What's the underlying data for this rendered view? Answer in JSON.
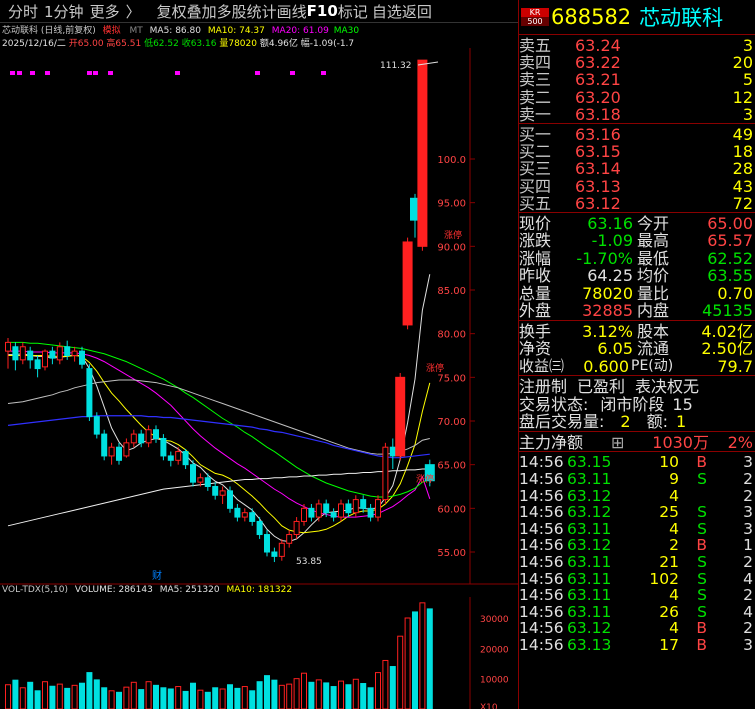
{
  "topbar": {
    "items": [
      "分时",
      "1分钟",
      "更多",
      "〉",
      "复权",
      "叠加",
      "多股",
      "统计",
      "画线",
      "F10",
      "标记",
      "自选",
      "返回"
    ]
  },
  "chart_info": {
    "line1": "芯动联科 (日线,前复权)",
    "tag": "模拟",
    "ma_label": "MT",
    "ma5": "MA5: 86.80",
    "ma10": "MA10: 74.37",
    "ma20": "MA20: 61.09",
    "ma30": "MA30"
  },
  "bar_info": {
    "date": "2025/12/16/二",
    "open": "开65.00",
    "high": "高65.51",
    "low": "低62.52",
    "close": "收63.16",
    "vol": "量78020",
    "amount": "额4.96亿",
    "change": "幅-1.09(-1.7"
  },
  "price_axis": [
    "100.0",
    "95.00",
    "90.00",
    "85.00",
    "80.00",
    "75.00",
    "70.00",
    "65.00",
    "60.00",
    "55.00"
  ],
  "annotations": {
    "high_mark": "111.32",
    "low_mark": "53.85",
    "cai": "财",
    "event1": "涨停",
    "event2": "涨停",
    "event3": "涨停"
  },
  "volume_info": {
    "title": "VOL-TDX(5,10)",
    "volume": "VOLUME: 286143",
    "ma5": "MA5: 251320",
    "ma10": "MA10: 181322"
  },
  "volume_axis": [
    "30000",
    "20000",
    "10000",
    "X10"
  ],
  "stock": {
    "market": "KR",
    "index": "500",
    "code": "688582",
    "name": "芯动联科"
  },
  "order_book": {
    "asks": [
      {
        "label": "卖五",
        "price": "63.24",
        "vol": "3"
      },
      {
        "label": "卖四",
        "price": "63.22",
        "vol": "20"
      },
      {
        "label": "卖三",
        "price": "63.21",
        "vol": "5"
      },
      {
        "label": "卖二",
        "price": "63.20",
        "vol": "12"
      },
      {
        "label": "卖一",
        "price": "63.18",
        "vol": "3"
      }
    ],
    "bids": [
      {
        "label": "买一",
        "price": "63.16",
        "vol": "49"
      },
      {
        "label": "买二",
        "price": "63.15",
        "vol": "18"
      },
      {
        "label": "买三",
        "price": "63.14",
        "vol": "28"
      },
      {
        "label": "买四",
        "price": "63.13",
        "vol": "43"
      },
      {
        "label": "买五",
        "price": "63.12",
        "vol": "72"
      }
    ]
  },
  "quote": [
    {
      "l1": "现价",
      "v1": "63.16",
      "l2": "今开",
      "v2": "65.00"
    },
    {
      "l1": "涨跌",
      "v1": "-1.09",
      "l2": "最高",
      "v2": "65.57"
    },
    {
      "l1": "涨幅",
      "v1": "-1.70%",
      "l2": "最低",
      "v2": "62.52"
    },
    {
      "l1": "昨收",
      "v1": "64.25",
      "l2": "均价",
      "v2": "63.55"
    },
    {
      "l1": "总量",
      "v1": "78020",
      "l2": "量比",
      "v2": "0.70"
    },
    {
      "l1": "外盘",
      "v1": "32885",
      "l2": "内盘",
      "v2": "45135"
    }
  ],
  "fundamentals": [
    {
      "l1": "换手",
      "v1": "3.12%",
      "l2": "股本",
      "v2": "4.02亿"
    },
    {
      "l1": "净资",
      "v1": "6.05",
      "l2": "流通",
      "v2": "2.50亿"
    },
    {
      "l1": "收益㈢",
      "v1": "0.600",
      "l2": "PE(动)",
      "v2": "79.7"
    }
  ],
  "status": {
    "reg": "注册制",
    "profit": "已盈利",
    "vote": "表决权无",
    "trade_state_label": "交易状态:",
    "trade_state": "闭市阶段",
    "trade_state_num": "15",
    "after_label": "盘后交易量:",
    "after_vol": "2",
    "amount_label": "额:",
    "amount_val": "1"
  },
  "main_net": {
    "label": "主力净额",
    "value": "1030万",
    "pct": "2%"
  },
  "trades": [
    {
      "time": "14:56",
      "price": "63.15",
      "vol": "10",
      "dir": "B",
      "n": "3"
    },
    {
      "time": "14:56",
      "price": "63.11",
      "vol": "9",
      "dir": "S",
      "n": "2"
    },
    {
      "time": "14:56",
      "price": "63.12",
      "vol": "4",
      "dir": "",
      "n": "2"
    },
    {
      "time": "14:56",
      "price": "63.12",
      "vol": "25",
      "dir": "S",
      "n": "3"
    },
    {
      "time": "14:56",
      "price": "63.11",
      "vol": "4",
      "dir": "S",
      "n": "3"
    },
    {
      "time": "14:56",
      "price": "63.12",
      "vol": "2",
      "dir": "B",
      "n": "1"
    },
    {
      "time": "14:56",
      "price": "63.11",
      "vol": "21",
      "dir": "S",
      "n": "2"
    },
    {
      "time": "14:56",
      "price": "63.11",
      "vol": "102",
      "dir": "S",
      "n": "4"
    },
    {
      "time": "14:56",
      "price": "63.11",
      "vol": "4",
      "dir": "S",
      "n": "2"
    },
    {
      "time": "14:56",
      "price": "63.11",
      "vol": "26",
      "dir": "S",
      "n": "4"
    },
    {
      "time": "14:56",
      "price": "63.12",
      "vol": "4",
      "dir": "B",
      "n": "2"
    },
    {
      "time": "14:56",
      "price": "63.13",
      "vol": "17",
      "dir": "B",
      "n": "3"
    }
  ],
  "candles": [
    [
      78.0,
      79.0,
      76.0,
      79.5,
      1
    ],
    [
      78.5,
      77.0,
      75.8,
      79.0,
      0
    ],
    [
      77.0,
      78.5,
      76.5,
      79.0,
      1
    ],
    [
      78.0,
      77.0,
      76.0,
      78.5,
      0
    ],
    [
      77.0,
      76.0,
      75.0,
      77.5,
      0
    ],
    [
      76.2,
      78.0,
      75.8,
      78.2,
      1
    ],
    [
      78.0,
      77.2,
      76.5,
      78.5,
      0
    ],
    [
      77.0,
      78.5,
      76.5,
      79.0,
      1
    ],
    [
      78.5,
      77.5,
      77.0,
      79.2,
      0
    ],
    [
      77.5,
      78.0,
      76.8,
      78.5,
      1
    ],
    [
      78.0,
      76.5,
      76.0,
      78.5,
      0
    ],
    [
      76.0,
      70.5,
      70.0,
      76.5,
      0
    ],
    [
      70.5,
      68.5,
      68.0,
      71.0,
      0
    ],
    [
      68.5,
      66.0,
      65.5,
      69.0,
      0
    ],
    [
      66.0,
      67.0,
      65.0,
      67.5,
      1
    ],
    [
      67.0,
      65.5,
      65.0,
      67.5,
      0
    ],
    [
      66.0,
      67.5,
      65.8,
      68.0,
      1
    ],
    [
      67.5,
      68.5,
      67.0,
      69.0,
      1
    ],
    [
      68.5,
      67.5,
      67.0,
      69.0,
      0
    ],
    [
      67.5,
      69.0,
      67.0,
      69.5,
      1
    ],
    [
      69.0,
      68.0,
      67.5,
      69.5,
      0
    ],
    [
      68.0,
      66.0,
      65.5,
      68.5,
      0
    ],
    [
      66.0,
      65.5,
      64.8,
      66.5,
      0
    ],
    [
      65.5,
      66.5,
      65.0,
      67.0,
      1
    ],
    [
      66.5,
      65.0,
      64.5,
      66.8,
      0
    ],
    [
      65.0,
      63.0,
      62.5,
      65.5,
      0
    ],
    [
      63.0,
      63.5,
      62.5,
      64.0,
      1
    ],
    [
      63.5,
      62.5,
      62.0,
      64.0,
      0
    ],
    [
      62.5,
      61.5,
      61.0,
      63.0,
      0
    ],
    [
      61.5,
      62.0,
      60.5,
      62.5,
      1
    ],
    [
      62.0,
      60.0,
      59.5,
      62.5,
      0
    ],
    [
      60.0,
      59.0,
      58.5,
      60.5,
      0
    ],
    [
      59.0,
      59.5,
      58.5,
      60.0,
      1
    ],
    [
      59.5,
      58.5,
      58.0,
      60.0,
      0
    ],
    [
      58.5,
      57.0,
      56.5,
      59.0,
      0
    ],
    [
      57.0,
      55.0,
      54.5,
      57.5,
      0
    ],
    [
      55.0,
      54.5,
      53.85,
      55.5,
      0
    ],
    [
      54.5,
      56.0,
      54.0,
      56.5,
      1
    ],
    [
      56.0,
      57.0,
      55.5,
      57.5,
      1
    ],
    [
      57.0,
      58.5,
      56.5,
      59.0,
      1
    ],
    [
      58.5,
      60.0,
      58.0,
      60.5,
      1
    ],
    [
      60.0,
      59.0,
      58.5,
      60.5,
      0
    ],
    [
      59.0,
      60.5,
      58.5,
      61.0,
      1
    ],
    [
      60.5,
      59.5,
      59.0,
      61.0,
      0
    ],
    [
      59.5,
      59.0,
      58.5,
      60.0,
      0
    ],
    [
      59.0,
      60.5,
      58.5,
      61.0,
      1
    ],
    [
      60.5,
      59.5,
      59.0,
      61.0,
      0
    ],
    [
      59.5,
      61.0,
      59.0,
      61.5,
      1
    ],
    [
      61.0,
      60.0,
      59.5,
      61.5,
      0
    ],
    [
      60.0,
      59.0,
      58.5,
      60.5,
      0
    ],
    [
      59.0,
      61.0,
      58.5,
      61.5,
      1
    ],
    [
      61.0,
      67.0,
      60.5,
      67.5,
      1
    ],
    [
      67.0,
      66.0,
      64.5,
      68.0,
      0
    ],
    [
      66.0,
      75.0,
      65.5,
      75.5,
      1
    ],
    [
      81.0,
      90.5,
      80.5,
      91.0,
      1
    ],
    [
      93.0,
      95.5,
      91.0,
      96.0,
      0
    ],
    [
      90.0,
      111.32,
      89.5,
      111.32,
      1
    ],
    [
      65.0,
      63.16,
      62.52,
      65.57,
      0
    ]
  ],
  "ma_series": {
    "ma5": [
      77.6,
      77.6,
      77.7,
      77.5,
      77.4,
      77.4,
      77.2,
      77.3,
      77.4,
      77.6,
      77.4,
      76.0,
      74.0,
      71.6,
      69.2,
      67.6,
      66.6,
      66.9,
      67.5,
      67.8,
      68.0,
      67.8,
      67.3,
      66.8,
      66.1,
      65.2,
      64.7,
      63.8,
      63.1,
      62.7,
      61.9,
      61.0,
      60.4,
      59.8,
      58.8,
      57.6,
      56.8,
      56.3,
      56.2,
      56.5,
      57.2,
      58.1,
      58.9,
      59.5,
      59.6,
      59.7,
      59.8,
      60.1,
      60.0,
      59.9,
      60.1,
      61.2,
      62.6,
      65.6,
      69.8,
      74.8,
      82.7,
      86.8
    ],
    "ma10": [
      77.5,
      77.5,
      77.5,
      77.5,
      77.5,
      77.5,
      77.4,
      77.4,
      77.4,
      77.5,
      77.4,
      76.7,
      75.7,
      74.4,
      73.2,
      72.3,
      71.3,
      70.4,
      69.5,
      68.7,
      68.2,
      67.8,
      67.7,
      67.3,
      66.7,
      65.9,
      65.0,
      64.5,
      64.0,
      63.8,
      63.4,
      62.8,
      62.1,
      61.4,
      60.6,
      59.7,
      58.9,
      58.0,
      57.5,
      57.3,
      57.2,
      57.3,
      57.4,
      57.6,
      58.0,
      58.5,
      59.1,
      59.5,
      59.7,
      59.7,
      59.9,
      60.5,
      61.4,
      62.8,
      64.9,
      67.3,
      71.1,
      74.37
    ],
    "ma20": [
      78.0,
      78.0,
      78.0,
      77.9,
      77.9,
      77.9,
      77.8,
      77.8,
      77.8,
      77.8,
      77.7,
      77.5,
      77.2,
      76.8,
      76.3,
      75.8,
      75.3,
      74.8,
      74.3,
      73.8,
      73.2,
      72.5,
      71.8,
      70.9,
      70.0,
      69.1,
      68.3,
      67.6,
      66.9,
      66.3,
      65.7,
      65.1,
      64.6,
      64.0,
      63.4,
      62.8,
      62.2,
      61.7,
      61.1,
      60.6,
      60.2,
      59.8,
      59.5,
      59.3,
      59.1,
      59.0,
      59.0,
      59.0,
      59.1,
      59.2,
      59.4,
      59.8,
      60.2,
      60.8,
      61.5,
      62.1,
      63.6,
      61.09
    ],
    "ma30": [
      79.0,
      79.0,
      79.0,
      78.9,
      78.9,
      78.8,
      78.7,
      78.6,
      78.5,
      78.4,
      78.3,
      78.1,
      77.9,
      77.7,
      77.4,
      77.1,
      76.8,
      76.4,
      76.0,
      75.6,
      75.2,
      74.8,
      74.3,
      73.8,
      73.2,
      72.7,
      72.1,
      71.5,
      70.9,
      70.3,
      69.8,
      69.3,
      68.7,
      68.2,
      67.6,
      67.0,
      66.5,
      65.9,
      65.3,
      64.7,
      64.2,
      63.7,
      63.3,
      62.9,
      62.6,
      62.3,
      62.0,
      61.8,
      61.6,
      61.4,
      61.3,
      61.3,
      61.4,
      61.6,
      61.9,
      62.3,
      63.0,
      63.3
    ],
    "ma60": [
      72.0,
      72.1,
      72.2,
      72.4,
      72.6,
      72.8,
      73.0,
      73.3,
      73.5,
      73.8,
      74.0,
      74.2,
      74.4,
      74.5,
      74.6,
      74.7,
      74.7,
      74.7,
      74.6,
      74.5,
      74.4,
      74.2,
      74.0,
      73.8,
      73.5,
      73.2,
      72.9,
      72.6,
      72.3,
      72.0,
      71.7,
      71.4,
      71.1,
      70.8,
      70.5,
      70.2,
      69.9,
      69.6,
      69.3,
      69.0,
      68.7,
      68.4,
      68.1,
      67.8,
      67.5,
      67.2,
      66.9,
      66.7,
      66.5,
      66.3,
      66.2,
      66.2,
      66.3,
      66.5,
      66.8,
      67.2,
      67.8,
      68.0
    ],
    "ma120": [
      69.5,
      69.6,
      69.7,
      69.8,
      69.9,
      70.0,
      70.1,
      70.2,
      70.3,
      70.4,
      70.5,
      70.5,
      70.6,
      70.6,
      70.6,
      70.6,
      70.6,
      70.6,
      70.6,
      70.5,
      70.5,
      70.4,
      70.4,
      70.3,
      70.2,
      70.1,
      70.0,
      69.9,
      69.8,
      69.7,
      69.6,
      69.5,
      69.4,
      69.3,
      69.1,
      69.0,
      68.8,
      68.7,
      68.5,
      68.3,
      68.1,
      67.9,
      67.7,
      67.5,
      67.2,
      67.0,
      66.8,
      66.6,
      66.4,
      66.2,
      66.0,
      65.9,
      65.8,
      65.8,
      65.9,
      66.0,
      66.1,
      66.2
    ],
    "ma250": [
      58.0,
      58.2,
      58.4,
      58.6,
      58.8,
      59.0,
      59.2,
      59.4,
      59.6,
      59.8,
      60.0,
      60.2,
      60.4,
      60.6,
      60.8,
      61.0,
      61.2,
      61.4,
      61.6,
      61.8,
      62.0,
      62.2,
      62.3,
      62.4,
      62.5,
      62.6,
      62.7,
      62.8,
      62.9,
      63.0,
      63.1,
      63.2,
      63.3,
      63.3,
      63.4,
      63.4,
      63.5,
      63.5,
      63.6,
      63.6,
      63.7,
      63.7,
      63.8,
      63.8,
      63.9,
      63.9,
      64.0,
      64.0,
      64.1,
      64.1,
      64.2,
      64.2,
      64.3,
      64.3,
      64.4,
      64.4,
      64.5,
      64.5
    ]
  },
  "volumes": [
    80,
    95,
    70,
    88,
    60,
    90,
    75,
    82,
    68,
    78,
    85,
    120,
    96,
    70,
    60,
    55,
    72,
    88,
    64,
    90,
    78,
    70,
    66,
    74,
    58,
    85,
    62,
    55,
    70,
    66,
    80,
    68,
    74,
    60,
    90,
    110,
    95,
    78,
    82,
    100,
    118,
    88,
    96,
    86,
    74,
    92,
    80,
    98,
    84,
    70,
    120,
    160,
    140,
    240,
    300,
    320,
    350,
    330
  ]
}
